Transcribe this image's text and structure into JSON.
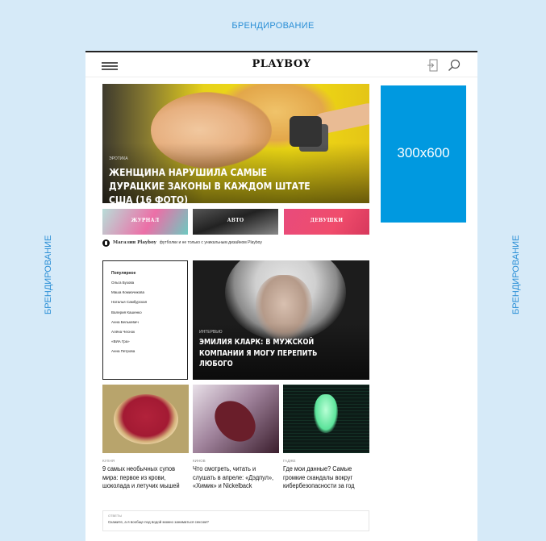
{
  "branding": {
    "top": "БРЕНДИРОВАНИЕ",
    "left": "БРЕНДИРОВАНИЕ",
    "right": "БРЕНДИРОВАНИЕ"
  },
  "header": {
    "logo": "PLAYBOY",
    "icons": [
      "menu-icon",
      "login-icon",
      "search-icon"
    ]
  },
  "hero": {
    "category": "ЭРОТИКА",
    "title": "ЖЕНЩИНА НАРУШИЛА САМЫЕ ДУРАЦКИЕ ЗАКОНЫ В КАЖДОМ ШТАТЕ США (16 ФОТО)"
  },
  "ad": {
    "label": "300x600",
    "color": "#0099e0"
  },
  "tiles": [
    {
      "label": "ЖУРНАЛ"
    },
    {
      "label": "АВТО"
    },
    {
      "label": "ДЕВУШКИ"
    }
  ],
  "magazine_line": {
    "brand": "Магазин Playboy",
    "text": "футболки и не только с уникальным дизайном Playboy"
  },
  "popular": {
    "heading": "Популярное",
    "items": [
      "Ольга Бузова",
      "Маша Комиачикова",
      "Наталья Самбурская",
      "Валерия Кашенко",
      "Анна Белькевич",
      "Алёна Чеснок",
      "«ВИА Гра»",
      "Анна Петрова"
    ]
  },
  "feature": {
    "category": "ИНТЕРВЬЮ",
    "title": "ЭМИЛИЯ КЛАРК: В МУЖСКОЙ КОМПАНИИ Я МОГУ ПЕРЕПИТЬ ЛЮБОГО"
  },
  "cards": [
    {
      "category": "КУХНЯ",
      "title": "9 самых необычных супов мира: первое из крови, шоколада и летучих мышей"
    },
    {
      "category": "КИНОВ",
      "title": "Что смотреть, читать и слушать в апреле: «Дэдпул», «Химик» и Nickelback"
    },
    {
      "category": "ГАДЖЕ",
      "title": "Где мои данные? Самые громкие скандалы вокруг кибербезопасности за год"
    }
  ],
  "related": {
    "label": "ОТВЕТЫ",
    "text": "Скажите, а я вообще под водой можно заниматься сексом?"
  }
}
